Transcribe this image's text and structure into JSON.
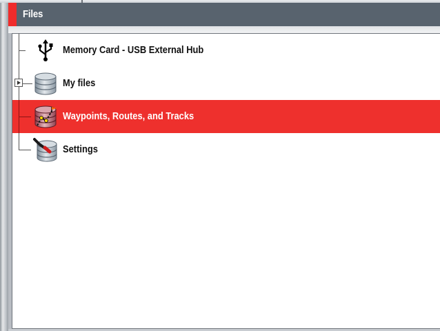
{
  "window": {
    "title": "Files"
  },
  "tree": {
    "items": [
      {
        "label": "Memory Card - USB External Hub",
        "icon": "usb-icon",
        "expandable": false,
        "selected": false
      },
      {
        "label": "My files",
        "icon": "database-icon",
        "expandable": true,
        "selected": false
      },
      {
        "label": "Waypoints, Routes, and Tracks",
        "icon": "waypoints-database-icon",
        "expandable": false,
        "selected": true
      },
      {
        "label": "Settings",
        "icon": "settings-database-icon",
        "expandable": false,
        "selected": false
      }
    ]
  },
  "colors": {
    "titlebar": "#58636e",
    "accent": "#ef2b2b",
    "selection": "#ee302d"
  }
}
